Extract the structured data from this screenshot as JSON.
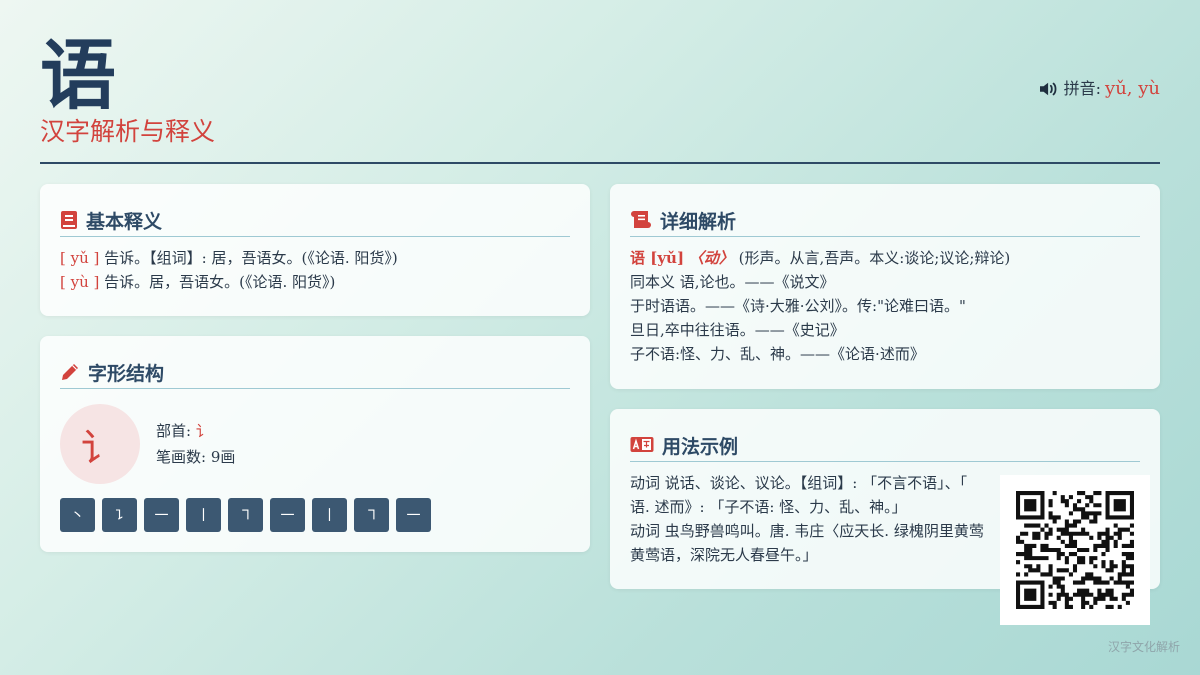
{
  "header": {
    "character": "语",
    "subtitle": "汉字解析与释义",
    "pinyin_label": "拼音: ",
    "pinyin_value": "yǔ, yù",
    "icon": "speaker-icon"
  },
  "basic": {
    "title": "基本释义",
    "icon": "book-icon",
    "entries": [
      {
        "pron": "[ yǔ ]",
        "text": " 告诉。【组词】: 居，吾语女。(《论语. 阳货》)"
      },
      {
        "pron": "[ yù ]",
        "text": " 告诉。居，吾语女。(《论语. 阳货》)"
      }
    ]
  },
  "structure": {
    "title": "字形结构",
    "icon": "pencil-icon",
    "radical": "讠",
    "radical_label": "部首: ",
    "radical_value": "讠",
    "strokes_label": "笔画数: 9画",
    "strokes": [
      "丶",
      "㇊",
      "一",
      "丨",
      "㇕",
      "一",
      "丨",
      "㇕",
      "一"
    ]
  },
  "detail": {
    "title": "详细解析",
    "icon": "scroll-icon",
    "head_char": "语 [yǔ]",
    "head_pos": "〈动〉",
    "head_text": " (形声。从言,吾声。本义:谈论;议论;辩论)",
    "lines": [
      "同本义 语,论也。——《说文》",
      "于时语语。——《诗·大雅·公刘》。传:\"论难曰语。\"",
      "旦日,卒中往往语。——《史记》",
      "子不语:怪、力、乱、神。——《论语·述而》"
    ]
  },
  "usage": {
    "title": "用法示例",
    "icon": "translate-icon",
    "lines": [
      "动词 说话、谈论、议论。【组词】: 「不言不语」、「",
      "语. 述而》: 「子不语: 怪、力、乱、神。」",
      "动词 虫鸟野兽鸣叫。唐. 韦庄〈应天长. 绿槐阴里黄莺",
      "黄莺语，深院无人春昼午。」"
    ]
  },
  "footer": {
    "text": "汉字文化解析"
  },
  "colors": {
    "accent": "#d2433d",
    "navy": "#2e4a66",
    "stroke_bg": "#3c5872"
  }
}
